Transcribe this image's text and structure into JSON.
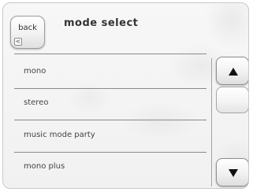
{
  "header": {
    "back_label": "back",
    "back_arrow_glyph": "<",
    "title": "mode select"
  },
  "mode_list": {
    "items": [
      {
        "label": "mono"
      },
      {
        "label": "stereo"
      },
      {
        "label": "music mode party"
      },
      {
        "label": "mono plus"
      }
    ]
  },
  "scrollbar": {
    "up_icon": "triangle-up-icon",
    "down_icon": "triangle-down-icon"
  }
}
